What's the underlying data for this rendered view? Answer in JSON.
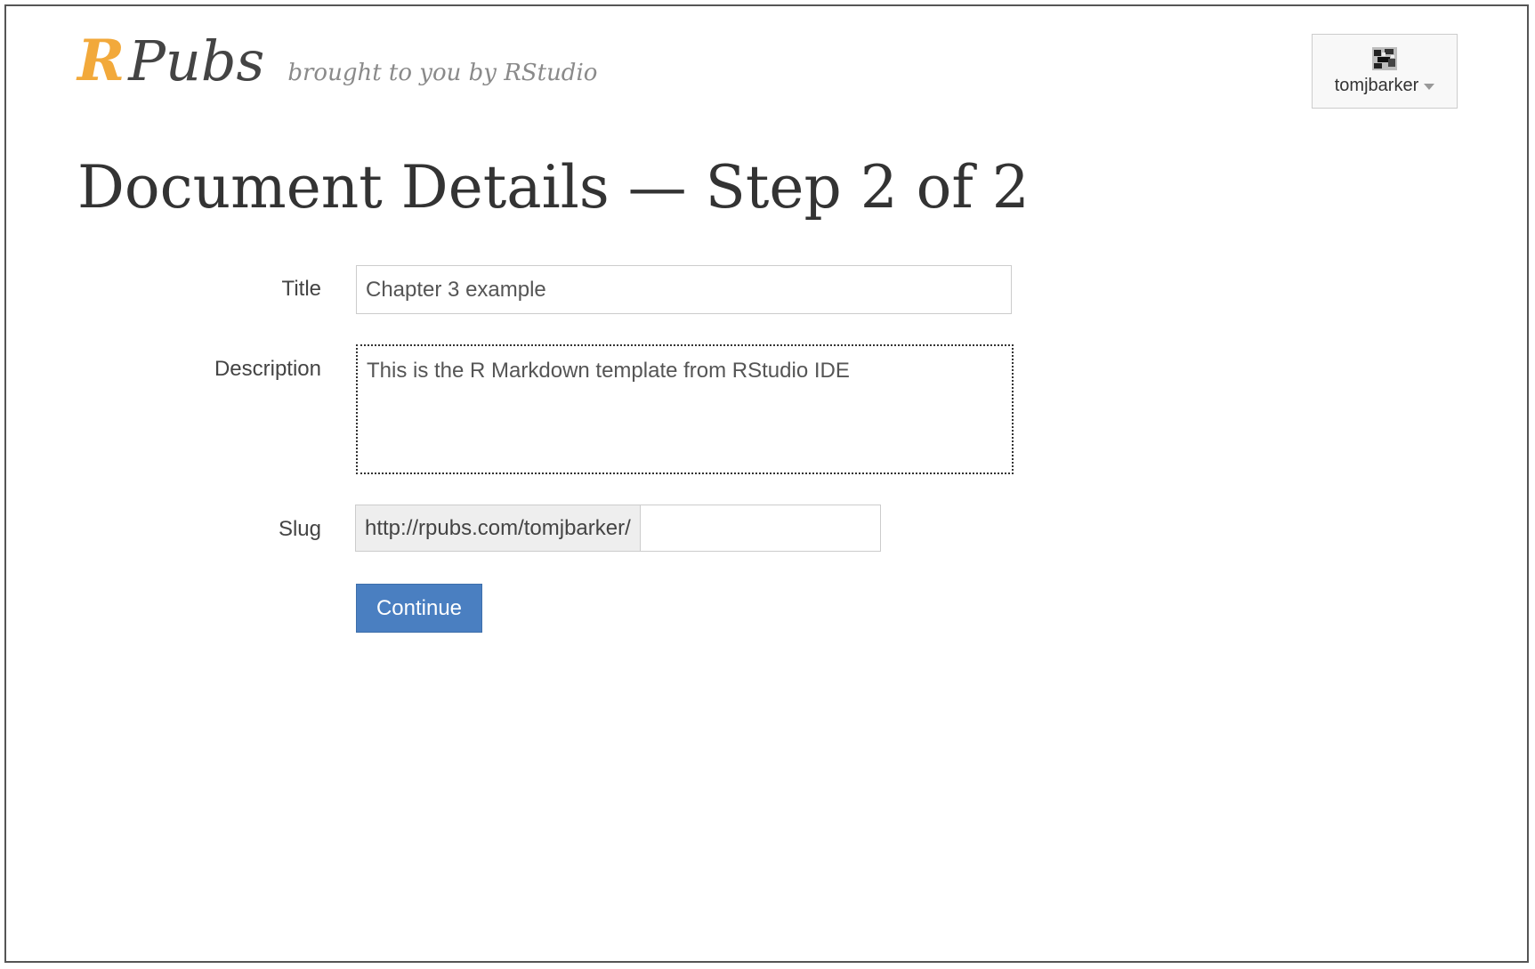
{
  "header": {
    "logo_r": "R",
    "logo_pubs": "Pubs",
    "tagline": "brought to you by RStudio",
    "user": {
      "username": "tomjbarker",
      "avatar_icon": "avatar-icon",
      "dropdown_icon": "caret-down-icon"
    }
  },
  "page": {
    "title": "Document Details — Step 2 of 2"
  },
  "form": {
    "title_label": "Title",
    "title_value": "Chapter 3 example",
    "description_label": "Description",
    "description_value": "This is the R Markdown template from RStudio IDE",
    "slug_label": "Slug",
    "slug_prefix": "http://rpubs.com/tomjbarker/",
    "slug_value": "",
    "submit_label": "Continue"
  },
  "colors": {
    "logo_accent": "#f2a93b",
    "button_primary": "#4a7fc1"
  }
}
